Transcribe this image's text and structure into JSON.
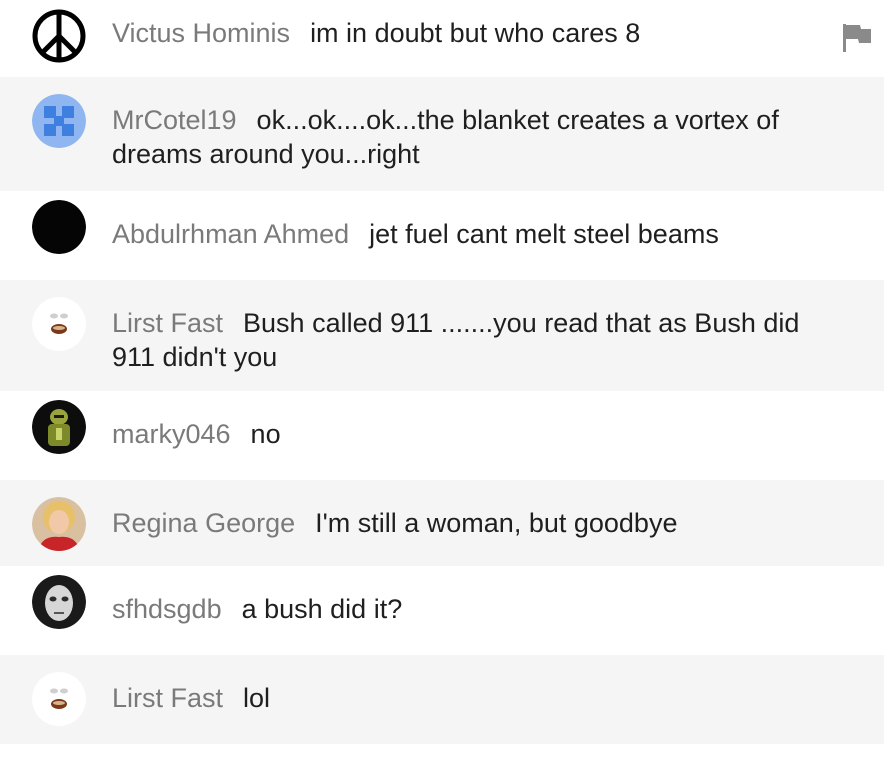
{
  "messages": [
    {
      "author": "Victus Hominis",
      "text": "im in doubt but who cares 8",
      "avatar": "peace-sign-icon"
    },
    {
      "author": "MrCotel19",
      "text": "ok...ok....ok...the blanket creates a vortex of dreams around you...right",
      "avatar": "blue-pattern-avatar"
    },
    {
      "author": "Abdulrhman Ahmed",
      "text": "jet fuel cant melt steel beams",
      "avatar": "black-avatar"
    },
    {
      "author": "Lirst Fast",
      "text": "Bush called 911 .......you read that as Bush did 911 didn't you",
      "avatar": "face-avatar"
    },
    {
      "author": "marky046",
      "text": "no",
      "avatar": "green-figure-avatar"
    },
    {
      "author": "Regina George",
      "text": "I'm still a woman, but goodbye",
      "avatar": "woman-photo-avatar"
    },
    {
      "author": "sfhdsgdb",
      "text": "a bush did it?",
      "avatar": "mask-avatar"
    },
    {
      "author": "Lirst Fast",
      "text": "lol",
      "avatar": "face-avatar"
    }
  ],
  "colors": {
    "author": "#7a7a7a",
    "text": "#1f1f1f",
    "alt_row": "#f5f5f5"
  },
  "icons": {
    "flag": "flag-icon"
  }
}
